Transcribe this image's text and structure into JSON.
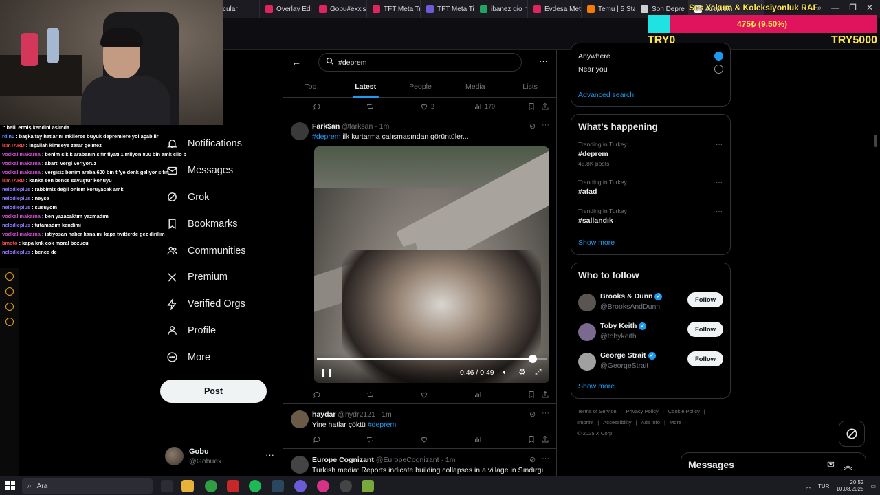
{
  "browser": {
    "tabs": [
      {
        "label": "cular",
        "color": "#3a3a3a"
      },
      {
        "label": "Overlay Edi",
        "color": "#e0245e"
      },
      {
        "label": "Gobu#exx's",
        "color": "#e0245e"
      },
      {
        "label": "TFT Meta Tr",
        "color": "#e0245e"
      },
      {
        "label": "TFT Meta Ti",
        "color": "#6b5bd6"
      },
      {
        "label": "ibanez gio m",
        "color": "#21a366"
      },
      {
        "label": "Evdesa Met",
        "color": "#e0245e"
      },
      {
        "label": "Temu | 5 Sta",
        "color": "#f57c00"
      },
      {
        "label": "Son Depre",
        "color": "#cfcfcf"
      },
      {
        "label": "#deprem",
        "color": "#ffffff"
      }
    ]
  },
  "overlay": {
    "title": "Ses Yakum & Koleksiyonluk RAF",
    "percent_label": "475₺ (9.50%)",
    "progress": 0.095,
    "min_label": "TRY0",
    "max_label": "TRY5000"
  },
  "chat": [
    {
      "user": "",
      "user_color": "#ff4d4d",
      "text": ": belli etmiş kendini aslında"
    },
    {
      "user": "rdin0",
      "user_color": "#5b8cff",
      "text": ": başka fay hatlarını etkilerse büyük depremlere yol açabilir"
    },
    {
      "user": "ismTARD",
      "user_color": "#ff4d4d",
      "text": ": inşallah kimseye zarar gelmez"
    },
    {
      "user": "vodkalimakarna",
      "user_color": "#d04fd0",
      "text": ": benim sikik arabanın sıfır fiyatı 1 milyon 800 bin amk clio bok gibi araba"
    },
    {
      "user": "vodkalimakarna",
      "user_color": "#d04fd0",
      "text": ": abartı vergi veriyoruz"
    },
    {
      "user": "vodkalimakarna",
      "user_color": "#d04fd0",
      "text": ": vergisiz benim araba 600 bin tl'ye denk geliyor sıfırı"
    },
    {
      "user": "ismTARD",
      "user_color": "#ff4d4d",
      "text": ": kanka sen bence savuştur konuyu"
    },
    {
      "user": "nelodieplus",
      "user_color": "#8f7cff",
      "text": ": rabbimiz değil önlem koruyacak amk"
    },
    {
      "user": "nelodieplus",
      "user_color": "#8f7cff",
      "text": ": neyse"
    },
    {
      "user": "nelodieplus",
      "user_color": "#8f7cff",
      "text": ": susuyom"
    },
    {
      "user": "vodkalimakarna",
      "user_color": "#d04fd0",
      "text": ": ben yazacaktım yazmadım"
    },
    {
      "user": "nelodieplus",
      "user_color": "#8f7cff",
      "text": ": tutamadım kendimi"
    },
    {
      "user": "vodkalimakarna",
      "user_color": "#d04fd0",
      "text": ": istiyosan haber kanalını kapa twitterde gez dirilim"
    },
    {
      "user": "bmoto",
      "user_color": "#ff4d4d",
      "text": ": kapa knk cok moral bozucu"
    },
    {
      "user": "nelodieplus",
      "user_color": "#8f7cff",
      "text": ": bence de"
    }
  ],
  "nav": {
    "items": [
      {
        "label": "Notifications",
        "icon": "bell-icon"
      },
      {
        "label": "Messages",
        "icon": "envelope-icon"
      },
      {
        "label": "Grok",
        "icon": "grok-icon"
      },
      {
        "label": "Bookmarks",
        "icon": "bookmark-icon"
      },
      {
        "label": "Communities",
        "icon": "people-icon"
      },
      {
        "label": "Premium",
        "icon": "x-logo-icon"
      },
      {
        "label": "Verified Orgs",
        "icon": "lightning-icon"
      },
      {
        "label": "Profile",
        "icon": "person-icon"
      },
      {
        "label": "More",
        "icon": "more-circle-icon"
      }
    ],
    "post_label": "Post",
    "account": {
      "name": "Gobu",
      "handle": "@Gobuex",
      "more": "···"
    }
  },
  "search": {
    "value": "#deprem",
    "placeholder": "Search"
  },
  "search_tabs": [
    "Top",
    "Latest",
    "People",
    "Media",
    "Lists"
  ],
  "active_tab": "Latest",
  "prev_tweet_actions": {
    "likes": "2",
    "views": "170"
  },
  "tweets": [
    {
      "name": "Fark$an",
      "handle": "@farksan",
      "time": "1m",
      "hashtag": "#deprem",
      "text": " ilk kurtarma çalışmasından görüntüler...",
      "avatar_color": "#3a3a3a"
    },
    {
      "name": "haydar",
      "handle": "@hydr2121",
      "time": "1m",
      "text": "Yine hatlar çöktü ",
      "hashtag": "#deprem",
      "avatar_color": "#6b5a46"
    },
    {
      "name": "Europe Cognizant",
      "handle": "@EuropeCognizant",
      "time": "1m",
      "text": "Turkish media: Reports indicate building collapses in a village in Sındırgı",
      "avatar_color": "#444444"
    }
  ],
  "video": {
    "time_label": "0:46 / 0:49",
    "progress": 0.939
  },
  "location_card": {
    "options": [
      {
        "label": "Anywhere",
        "selected": true
      },
      {
        "label": "Near you",
        "selected": false
      }
    ],
    "advanced": "Advanced search"
  },
  "happening": {
    "title": "What’s happening",
    "trends": [
      {
        "context": "Trending in Turkey",
        "name": "#deprem",
        "count": "45.8K posts"
      },
      {
        "context": "Trending in Turkey",
        "name": "#afad",
        "count": ""
      },
      {
        "context": "Trending in Turkey",
        "name": "#sallandık",
        "count": ""
      }
    ],
    "show_more": "Show more"
  },
  "who_to_follow": {
    "title": "Who to follow",
    "people": [
      {
        "name": "Brooks & Dunn",
        "handle": "@BrooksAndDunn",
        "avatar_color": "#5a5550"
      },
      {
        "name": "Toby Keith",
        "handle": "@tobykeith",
        "avatar_color": "#7a6a90"
      },
      {
        "name": "George Strait",
        "handle": "@GeorgeStrait",
        "avatar_color": "#a0a0a0"
      }
    ],
    "follow_label": "Follow",
    "show_more": "Show more"
  },
  "footer": {
    "links": [
      "Terms of Service",
      "|",
      "Privacy Policy",
      "|",
      "Cookie Policy",
      "|",
      "Imprint",
      "|",
      "Accessibility",
      "|",
      "Ads info",
      "|",
      "More ···"
    ],
    "copyright": "© 2025 X Corp."
  },
  "messages_drawer": {
    "title": "Messages"
  },
  "taskbar": {
    "search_label": "Ara",
    "lang": "TUR",
    "time": "20:52",
    "date": "10.08.2025"
  }
}
